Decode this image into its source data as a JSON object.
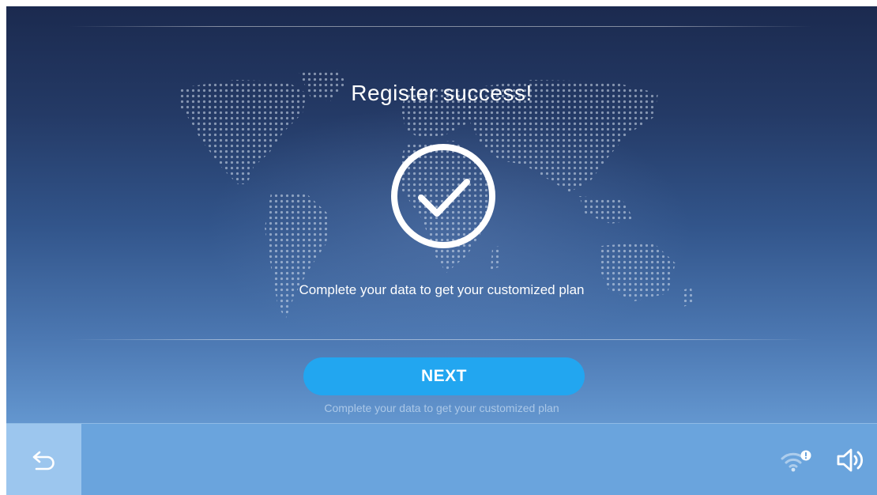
{
  "screen": {
    "title": "Register success!",
    "subtitle": "Complete your data to get your customized plan",
    "next_button_label": "NEXT",
    "hint": "Complete your data to get your customized plan"
  },
  "bottom_bar": {
    "icons": [
      "back-arrow-icon",
      "wifi-alert-icon",
      "volume-icon"
    ]
  },
  "colors": {
    "accent": "#22a6f0",
    "bar": "#6aa4dd",
    "back_button": "#9cc6ee",
    "background_top": "#1b2a4f"
  }
}
